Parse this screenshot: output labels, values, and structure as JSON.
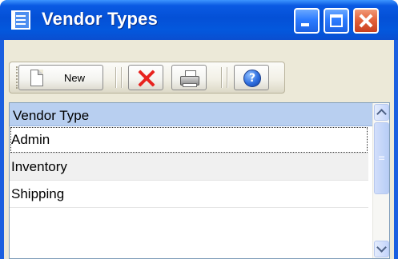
{
  "window": {
    "title": "Vendor Types"
  },
  "toolbar": {
    "new_label": "New"
  },
  "grid": {
    "column_header": "Vendor Type",
    "rows": [
      {
        "vendor_type": "Admin"
      },
      {
        "vendor_type": "Inventory"
      },
      {
        "vendor_type": "Shipping"
      }
    ]
  },
  "icons": {
    "app": "list-window-icon",
    "new": "new-document-icon",
    "delete": "red-x-icon",
    "print": "printer-icon",
    "help": "help-question-icon"
  },
  "colors": {
    "titlebar": "#0450d6",
    "header_row": "#b8cff0",
    "delete_red": "#e8231f",
    "client_bg": "#ece9d8"
  }
}
